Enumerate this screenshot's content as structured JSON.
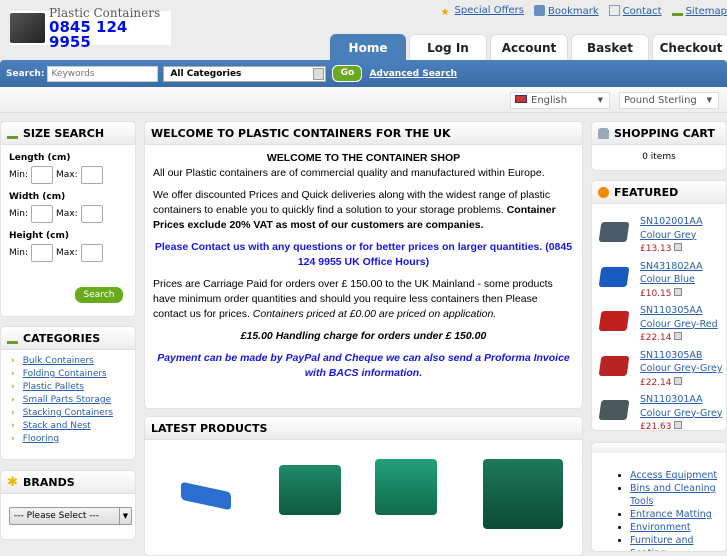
{
  "header": {
    "logo_line1": "Plastic Containers",
    "logo_phone": "0845 124 9955",
    "top_links": [
      {
        "label": "Special Offers",
        "icon": "star-icon"
      },
      {
        "label": "Bookmark",
        "icon": "bookmark-icon"
      },
      {
        "label": "Contact",
        "icon": "envelope-icon"
      },
      {
        "label": "Sitemap",
        "icon": "sitemap-icon"
      }
    ],
    "tabs": [
      {
        "label": "Home",
        "active": true
      },
      {
        "label": "Log In"
      },
      {
        "label": "Account"
      },
      {
        "label": "Basket"
      },
      {
        "label": "Checkout"
      }
    ]
  },
  "search": {
    "label": "Search:",
    "placeholder": "Keywords",
    "category": "All Categories",
    "go": "Go",
    "advanced": "Advanced Search"
  },
  "language": "English",
  "currency": "Pound Sterling",
  "size_search": {
    "title": "SIZE SEARCH",
    "fields": [
      "Length (cm)",
      "Width (cm)",
      "Height (cm)"
    ],
    "min": "Min:",
    "max": "Max:",
    "button": "Search"
  },
  "categories": {
    "title": "CATEGORIES",
    "items": [
      "Bulk Containers",
      "Folding Containers",
      "Plastic Pallets",
      "Small Parts Storage",
      "Stacking Containers",
      "Stack and Nest",
      "Flooring"
    ]
  },
  "brands": {
    "title": "BRANDS",
    "select": "--- Please Select ---"
  },
  "welcome": {
    "title": "WELCOME TO PLASTIC CONTAINERS FOR THE UK",
    "heading": "WELCOME TO THE CONTAINER SHOP",
    "p1": "All our Plastic containers are of commercial quality and manufactured within Europe.",
    "p2a": "We offer discounted Prices and Quick deliveries along with the widest range of plastic containers to enable you to quickly find a solution to your storage problems. ",
    "p2b": "Container Prices exclude 20% VAT as most of our customers are companies.",
    "p3": "Please Contact us with any questions or for better prices on larger quantities. (0845 124 9955 UK Office Hours)",
    "p4a": "Prices are Carriage Paid for orders over £ 150.00 to the UK Mainland - some products have minimum order quantities and should you require less containers then Please contact us for prices. ",
    "p4b": "Containers priced at £0.00 are priced on application.",
    "p5": "£15.00 Handling charge for orders under £ 150.00",
    "p6": "Payment can be made by PayPal and Cheque we can also send a Proforma Invoice with BACS information."
  },
  "latest": {
    "title": "LATEST PRODUCTS"
  },
  "cart": {
    "title": "SHOPPING CART",
    "items": "0 items"
  },
  "featured": {
    "title": "FEATURED",
    "items": [
      {
        "code": "SN102001AA",
        "colour": "Colour Grey",
        "price": "£13.13",
        "color": "#4a5a66"
      },
      {
        "code": "SN431802AA",
        "colour": "Colour Blue",
        "price": "£10.15",
        "color": "#1a5bc0"
      },
      {
        "code": "SN110305AA",
        "colour": "Colour Grey-Red",
        "price": "£22.14",
        "color": "#c02020"
      },
      {
        "code": "SN110305AB",
        "colour": "Colour Grey-Grey",
        "price": "£22.14",
        "color": "#b82424"
      },
      {
        "code": "SN110301AA",
        "colour": "Colour Grey-Grey",
        "price": "£21.63",
        "color": "#4a5a5a"
      }
    ]
  },
  "other_categories": [
    "Access Equipment",
    "Bins and Cleaning Tools",
    "Entrance Matting",
    "Environment",
    "Furniture and Seating"
  ]
}
